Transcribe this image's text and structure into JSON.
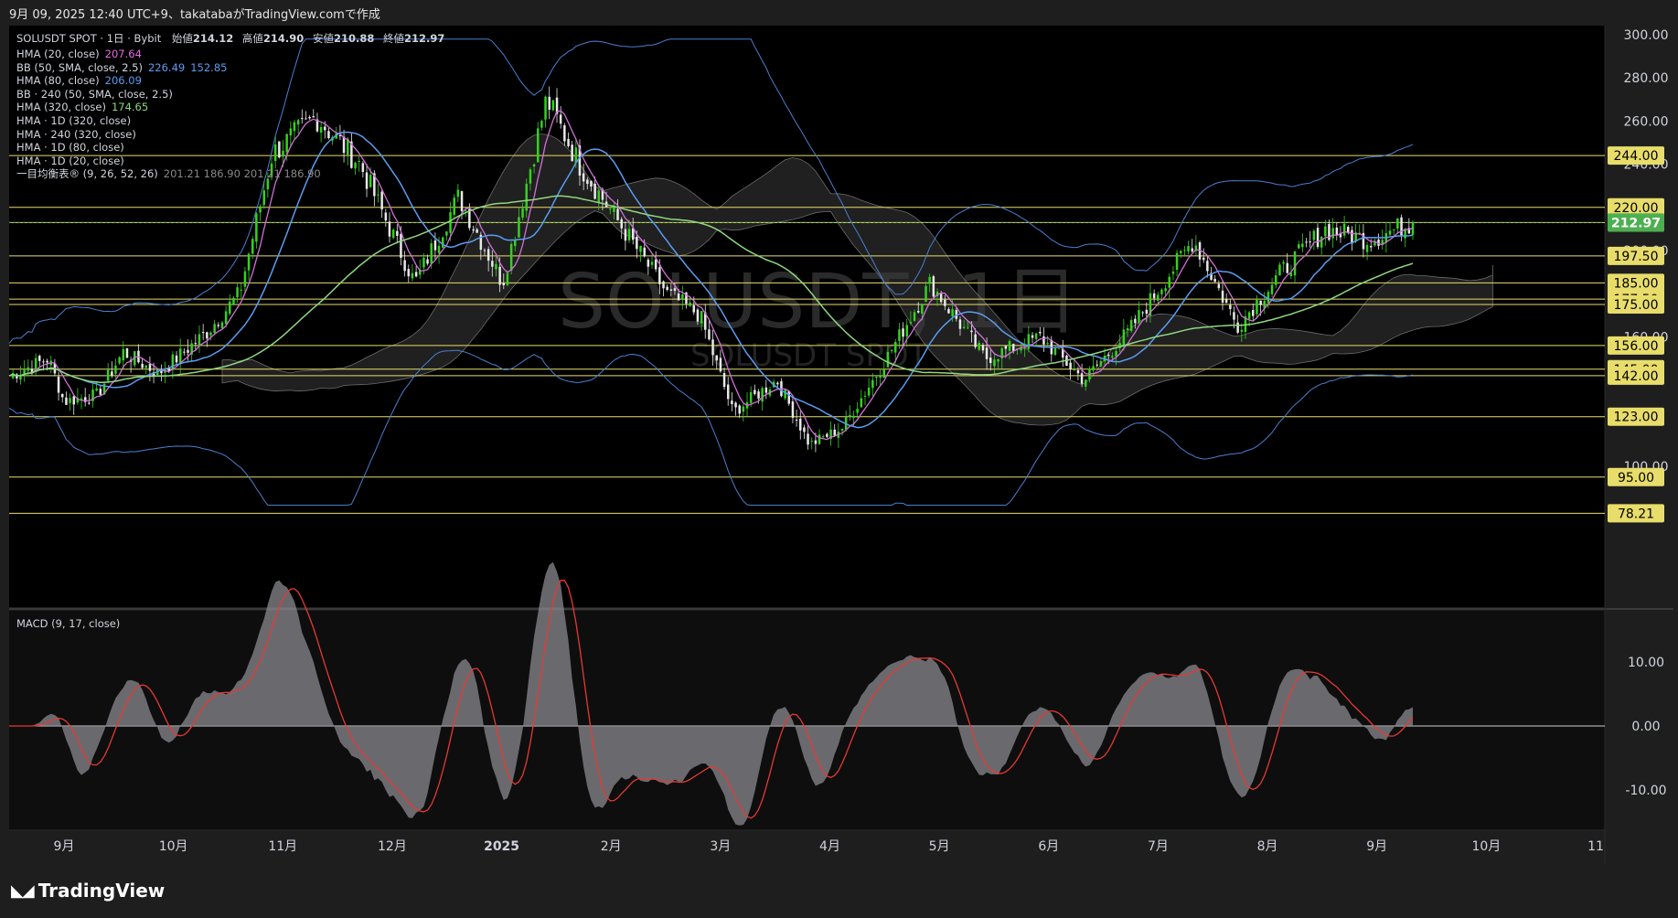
{
  "header": {
    "caption": "9月 09, 2025 12:40 UTC+9、takatabaがTradingView.comで作成"
  },
  "legend": {
    "symbol_line": {
      "label": "SOLUSDT SPOT · 1日 · Bybit",
      "open_label": "始値",
      "open": "214.12",
      "high_label": "高値",
      "high": "214.90",
      "low_label": "安値",
      "low": "210.88",
      "close_label": "終値",
      "close": "212.97"
    },
    "indicators": [
      {
        "label": "HMA (20, close)",
        "value": "207.64",
        "color": "#e070e0"
      },
      {
        "label": "BB (50, SMA, close, 2.5)",
        "value": "226.49",
        "value2": "152.85",
        "color": "#5b9cf0"
      },
      {
        "label": "HMA (80, close)",
        "value": "206.09",
        "color": "#5b9cf0"
      },
      {
        "label": "BB · 240 (50, SMA, close, 2.5)",
        "value": "",
        "value2": "",
        "color": "#d1d4dc"
      },
      {
        "label": "HMA (320, close)",
        "value": "174.65",
        "color": "#8fd880"
      },
      {
        "label": "HMA · 1D (320, close)",
        "value": "",
        "color": "#d1d4dc"
      },
      {
        "label": "HMA · 240 (320, close)",
        "value": "",
        "color": "#d1d4dc"
      },
      {
        "label": "HMA · 1D (80, close)",
        "value": "",
        "color": "#d1d4dc"
      },
      {
        "label": "HMA · 1D (20, close)",
        "value": "",
        "color": "#d1d4dc"
      },
      {
        "label": "一目均衡表® (9, 26, 52, 26)",
        "value": "201.21  186.90  201.21  186.90",
        "color": "#888888"
      }
    ]
  },
  "watermark": {
    "symbol": "SOLUSDT, 1日",
    "sub": "SOLUSDT SPOT"
  },
  "price_axis": {
    "ticks": [
      "300.00",
      "280.00",
      "260.00",
      "240.00",
      "200.00",
      "160.00",
      "100.00"
    ],
    "ticks_values": [
      300,
      280,
      260,
      240,
      200,
      160,
      100
    ],
    "hlines": [
      {
        "label": "244.00",
        "value": 244
      },
      {
        "label": "220.00",
        "value": 220
      },
      {
        "label": "213.00",
        "value": 213
      },
      {
        "label": "197.50",
        "value": 197.5
      },
      {
        "label": "185.00",
        "value": 185
      },
      {
        "label": "177.50",
        "value": 177.5
      },
      {
        "label": "175.00",
        "value": 175
      },
      {
        "label": "156.00",
        "value": 156
      },
      {
        "label": "145.00",
        "value": 145
      },
      {
        "label": "142.00",
        "value": 142
      },
      {
        "label": "123.00",
        "value": 123
      },
      {
        "label": "95.00",
        "value": 95
      },
      {
        "label": "78.21",
        "value": 78.21
      }
    ],
    "last_price": {
      "label": "212.97",
      "value": 212.97,
      "color": "#4caf50"
    },
    "hline_color": "#e8dd6a"
  },
  "macd_axis": {
    "title": "MACD (9, 17, close)",
    "ticks": [
      "10.00",
      "0.00",
      "-10.00"
    ],
    "ticks_values": [
      10,
      0,
      -10
    ]
  },
  "time_axis": {
    "labels": [
      "9月",
      "10月",
      "11月",
      "12月",
      "2025",
      "2月",
      "3月",
      "4月",
      "5月",
      "6月",
      "7月",
      "8月",
      "9月",
      "10月",
      "11"
    ]
  },
  "footer": {
    "brand": "TradingView"
  },
  "chart_data": {
    "type": "candlestick",
    "title": "SOLUSDT, 1日",
    "symbol": "SOLUSDT SPOT",
    "exchange": "Bybit",
    "timeframe": "1日",
    "ylim": [
      78.21,
      300
    ],
    "monthly_close_approx": [
      {
        "x": "2024-09",
        "y": 145
      },
      {
        "x": "2024-10",
        "y": 165
      },
      {
        "x": "2024-11",
        "y": 240
      },
      {
        "x": "2024-12",
        "y": 190
      },
      {
        "x": "2025-01",
        "y": 235
      },
      {
        "x": "2025-02",
        "y": 145
      },
      {
        "x": "2025-03",
        "y": 125
      },
      {
        "x": "2025-04",
        "y": 150
      },
      {
        "x": "2025-05",
        "y": 165
      },
      {
        "x": "2025-06",
        "y": 155
      },
      {
        "x": "2025-07",
        "y": 185
      },
      {
        "x": "2025-08",
        "y": 205
      },
      {
        "x": "2025-09",
        "y": 212.97
      }
    ],
    "series": [
      {
        "name": "HMA (20, close)",
        "last": 207.64
      },
      {
        "name": "BB (50, SMA, close, 2.5)",
        "upper": 226.49,
        "lower": 152.85
      },
      {
        "name": "HMA (80, close)",
        "last": 206.09
      },
      {
        "name": "HMA (320, close)",
        "last": 174.65
      }
    ],
    "last": {
      "open": 214.12,
      "high": 214.9,
      "low": 210.88,
      "close": 212.97
    },
    "macd_range": [
      -15,
      15
    ]
  }
}
